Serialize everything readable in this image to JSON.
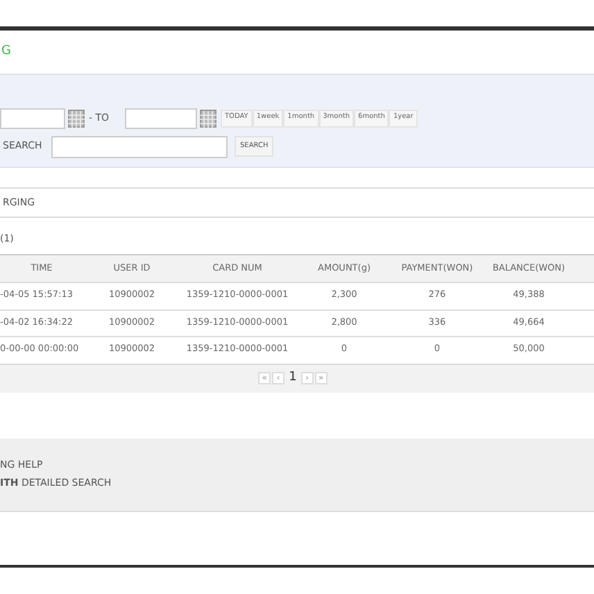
{
  "title": "G",
  "filter": {
    "to_label": "- TO",
    "ranges": [
      "TODAY",
      "1week",
      "1month",
      "3month",
      "6month",
      "1year"
    ],
    "search_label": "SEARCH",
    "search_button": "SEARCH"
  },
  "section": "RGING",
  "count": "(1)",
  "table": {
    "columns": [
      "TIME",
      "USER ID",
      "CARD NUM",
      "AMOUNT(g)",
      "PAYMENT(WON)",
      "BALANCE(WON)"
    ],
    "rows": [
      [
        "-04-05 15:57:13",
        "10900002",
        "1359-1210-0000-0001",
        "2,300",
        "276",
        "49,388"
      ],
      [
        "-04-02 16:34:22",
        "10900002",
        "1359-1210-0000-0001",
        "2,800",
        "336",
        "49,664"
      ],
      [
        "0-00-00 00:00:00",
        "10900002",
        "1359-1210-0000-0001",
        "0",
        "0",
        "50,000"
      ]
    ]
  },
  "pagination": [
    {
      "label": "«",
      "kind": "nav",
      "selected": false
    },
    {
      "label": "‹",
      "kind": "nav",
      "selected": false
    },
    {
      "label": "1",
      "kind": "page",
      "selected": true
    },
    {
      "label": "›",
      "kind": "nav",
      "selected": false
    },
    {
      "label": "»",
      "kind": "nav",
      "selected": false
    }
  ],
  "help": {
    "lines": [
      "NG HELP",
      "**ITH** DETAILED SEARCH"
    ]
  }
}
